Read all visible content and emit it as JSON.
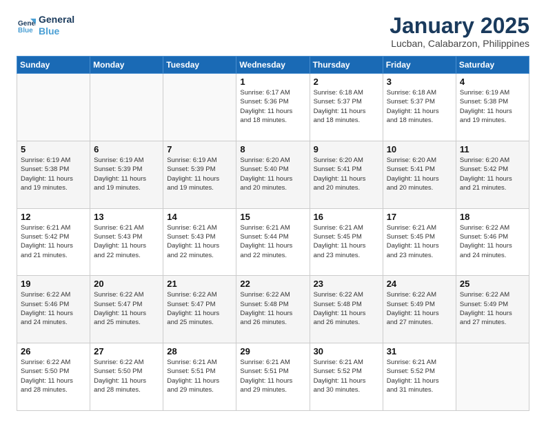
{
  "logo": {
    "line1": "General",
    "line2": "Blue"
  },
  "title": "January 2025",
  "subtitle": "Lucban, Calabarzon, Philippines",
  "days_header": [
    "Sunday",
    "Monday",
    "Tuesday",
    "Wednesday",
    "Thursday",
    "Friday",
    "Saturday"
  ],
  "weeks": [
    [
      {
        "day": "",
        "info": ""
      },
      {
        "day": "",
        "info": ""
      },
      {
        "day": "",
        "info": ""
      },
      {
        "day": "1",
        "info": "Sunrise: 6:17 AM\nSunset: 5:36 PM\nDaylight: 11 hours\nand 18 minutes."
      },
      {
        "day": "2",
        "info": "Sunrise: 6:18 AM\nSunset: 5:37 PM\nDaylight: 11 hours\nand 18 minutes."
      },
      {
        "day": "3",
        "info": "Sunrise: 6:18 AM\nSunset: 5:37 PM\nDaylight: 11 hours\nand 18 minutes."
      },
      {
        "day": "4",
        "info": "Sunrise: 6:19 AM\nSunset: 5:38 PM\nDaylight: 11 hours\nand 19 minutes."
      }
    ],
    [
      {
        "day": "5",
        "info": "Sunrise: 6:19 AM\nSunset: 5:38 PM\nDaylight: 11 hours\nand 19 minutes."
      },
      {
        "day": "6",
        "info": "Sunrise: 6:19 AM\nSunset: 5:39 PM\nDaylight: 11 hours\nand 19 minutes."
      },
      {
        "day": "7",
        "info": "Sunrise: 6:19 AM\nSunset: 5:39 PM\nDaylight: 11 hours\nand 19 minutes."
      },
      {
        "day": "8",
        "info": "Sunrise: 6:20 AM\nSunset: 5:40 PM\nDaylight: 11 hours\nand 20 minutes."
      },
      {
        "day": "9",
        "info": "Sunrise: 6:20 AM\nSunset: 5:41 PM\nDaylight: 11 hours\nand 20 minutes."
      },
      {
        "day": "10",
        "info": "Sunrise: 6:20 AM\nSunset: 5:41 PM\nDaylight: 11 hours\nand 20 minutes."
      },
      {
        "day": "11",
        "info": "Sunrise: 6:20 AM\nSunset: 5:42 PM\nDaylight: 11 hours\nand 21 minutes."
      }
    ],
    [
      {
        "day": "12",
        "info": "Sunrise: 6:21 AM\nSunset: 5:42 PM\nDaylight: 11 hours\nand 21 minutes."
      },
      {
        "day": "13",
        "info": "Sunrise: 6:21 AM\nSunset: 5:43 PM\nDaylight: 11 hours\nand 22 minutes."
      },
      {
        "day": "14",
        "info": "Sunrise: 6:21 AM\nSunset: 5:43 PM\nDaylight: 11 hours\nand 22 minutes."
      },
      {
        "day": "15",
        "info": "Sunrise: 6:21 AM\nSunset: 5:44 PM\nDaylight: 11 hours\nand 22 minutes."
      },
      {
        "day": "16",
        "info": "Sunrise: 6:21 AM\nSunset: 5:45 PM\nDaylight: 11 hours\nand 23 minutes."
      },
      {
        "day": "17",
        "info": "Sunrise: 6:21 AM\nSunset: 5:45 PM\nDaylight: 11 hours\nand 23 minutes."
      },
      {
        "day": "18",
        "info": "Sunrise: 6:22 AM\nSunset: 5:46 PM\nDaylight: 11 hours\nand 24 minutes."
      }
    ],
    [
      {
        "day": "19",
        "info": "Sunrise: 6:22 AM\nSunset: 5:46 PM\nDaylight: 11 hours\nand 24 minutes."
      },
      {
        "day": "20",
        "info": "Sunrise: 6:22 AM\nSunset: 5:47 PM\nDaylight: 11 hours\nand 25 minutes."
      },
      {
        "day": "21",
        "info": "Sunrise: 6:22 AM\nSunset: 5:47 PM\nDaylight: 11 hours\nand 25 minutes."
      },
      {
        "day": "22",
        "info": "Sunrise: 6:22 AM\nSunset: 5:48 PM\nDaylight: 11 hours\nand 26 minutes."
      },
      {
        "day": "23",
        "info": "Sunrise: 6:22 AM\nSunset: 5:48 PM\nDaylight: 11 hours\nand 26 minutes."
      },
      {
        "day": "24",
        "info": "Sunrise: 6:22 AM\nSunset: 5:49 PM\nDaylight: 11 hours\nand 27 minutes."
      },
      {
        "day": "25",
        "info": "Sunrise: 6:22 AM\nSunset: 5:49 PM\nDaylight: 11 hours\nand 27 minutes."
      }
    ],
    [
      {
        "day": "26",
        "info": "Sunrise: 6:22 AM\nSunset: 5:50 PM\nDaylight: 11 hours\nand 28 minutes."
      },
      {
        "day": "27",
        "info": "Sunrise: 6:22 AM\nSunset: 5:50 PM\nDaylight: 11 hours\nand 28 minutes."
      },
      {
        "day": "28",
        "info": "Sunrise: 6:21 AM\nSunset: 5:51 PM\nDaylight: 11 hours\nand 29 minutes."
      },
      {
        "day": "29",
        "info": "Sunrise: 6:21 AM\nSunset: 5:51 PM\nDaylight: 11 hours\nand 29 minutes."
      },
      {
        "day": "30",
        "info": "Sunrise: 6:21 AM\nSunset: 5:52 PM\nDaylight: 11 hours\nand 30 minutes."
      },
      {
        "day": "31",
        "info": "Sunrise: 6:21 AM\nSunset: 5:52 PM\nDaylight: 11 hours\nand 31 minutes."
      },
      {
        "day": "",
        "info": ""
      }
    ]
  ]
}
